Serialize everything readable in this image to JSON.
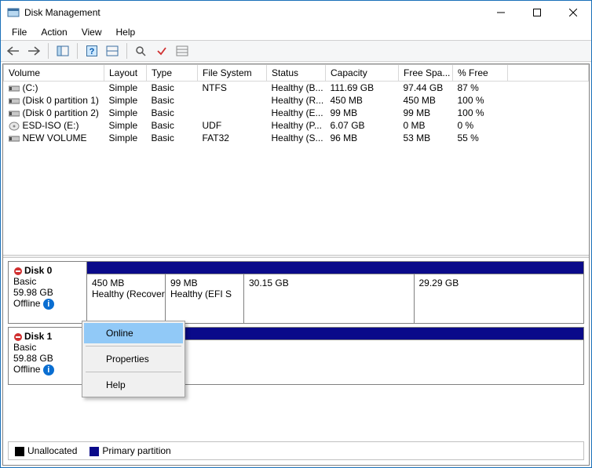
{
  "window": {
    "title": "Disk Management"
  },
  "menu": {
    "file": "File",
    "action": "Action",
    "view": "View",
    "help": "Help"
  },
  "columns": {
    "volume": "Volume",
    "layout": "Layout",
    "type": "Type",
    "fs": "File System",
    "status": "Status",
    "capacity": "Capacity",
    "free": "Free Spa...",
    "pct": "% Free"
  },
  "volumes": [
    {
      "name": "(C:)",
      "layout": "Simple",
      "type": "Basic",
      "fs": "NTFS",
      "status": "Healthy (B...",
      "capacity": "111.69 GB",
      "free": "97.44 GB",
      "pct": "87 %",
      "icon": "vol"
    },
    {
      "name": "(Disk 0 partition 1)",
      "layout": "Simple",
      "type": "Basic",
      "fs": "",
      "status": "Healthy (R...",
      "capacity": "450 MB",
      "free": "450 MB",
      "pct": "100 %",
      "icon": "vol"
    },
    {
      "name": "(Disk 0 partition 2)",
      "layout": "Simple",
      "type": "Basic",
      "fs": "",
      "status": "Healthy (E...",
      "capacity": "99 MB",
      "free": "99 MB",
      "pct": "100 %",
      "icon": "vol"
    },
    {
      "name": "ESD-ISO (E:)",
      "layout": "Simple",
      "type": "Basic",
      "fs": "UDF",
      "status": "Healthy (P...",
      "capacity": "6.07 GB",
      "free": "0 MB",
      "pct": "0 %",
      "icon": "disc"
    },
    {
      "name": "NEW VOLUME",
      "layout": "Simple",
      "type": "Basic",
      "fs": "FAT32",
      "status": "Healthy (S...",
      "capacity": "96 MB",
      "free": "53 MB",
      "pct": "55 %",
      "icon": "vol"
    }
  ],
  "disks": {
    "d0": {
      "title": "Disk 0",
      "type": "Basic",
      "size": "59.98 GB",
      "state": "Offline"
    },
    "d1": {
      "title": "Disk 1",
      "type": "Basic",
      "size": "59.88 GB",
      "state": "Offline"
    }
  },
  "parts": {
    "d0": [
      {
        "l1": "450 MB",
        "l2": "Healthy (Recovery"
      },
      {
        "l1": "99 MB",
        "l2": "Healthy (EFI S"
      },
      {
        "l1": "30.15 GB",
        "l2": ""
      },
      {
        "l1": "29.29 GB",
        "l2": ""
      }
    ]
  },
  "legend": {
    "unalloc": "Unallocated",
    "primary": "Primary partition"
  },
  "context": {
    "online": "Online",
    "properties": "Properties",
    "help": "Help"
  }
}
